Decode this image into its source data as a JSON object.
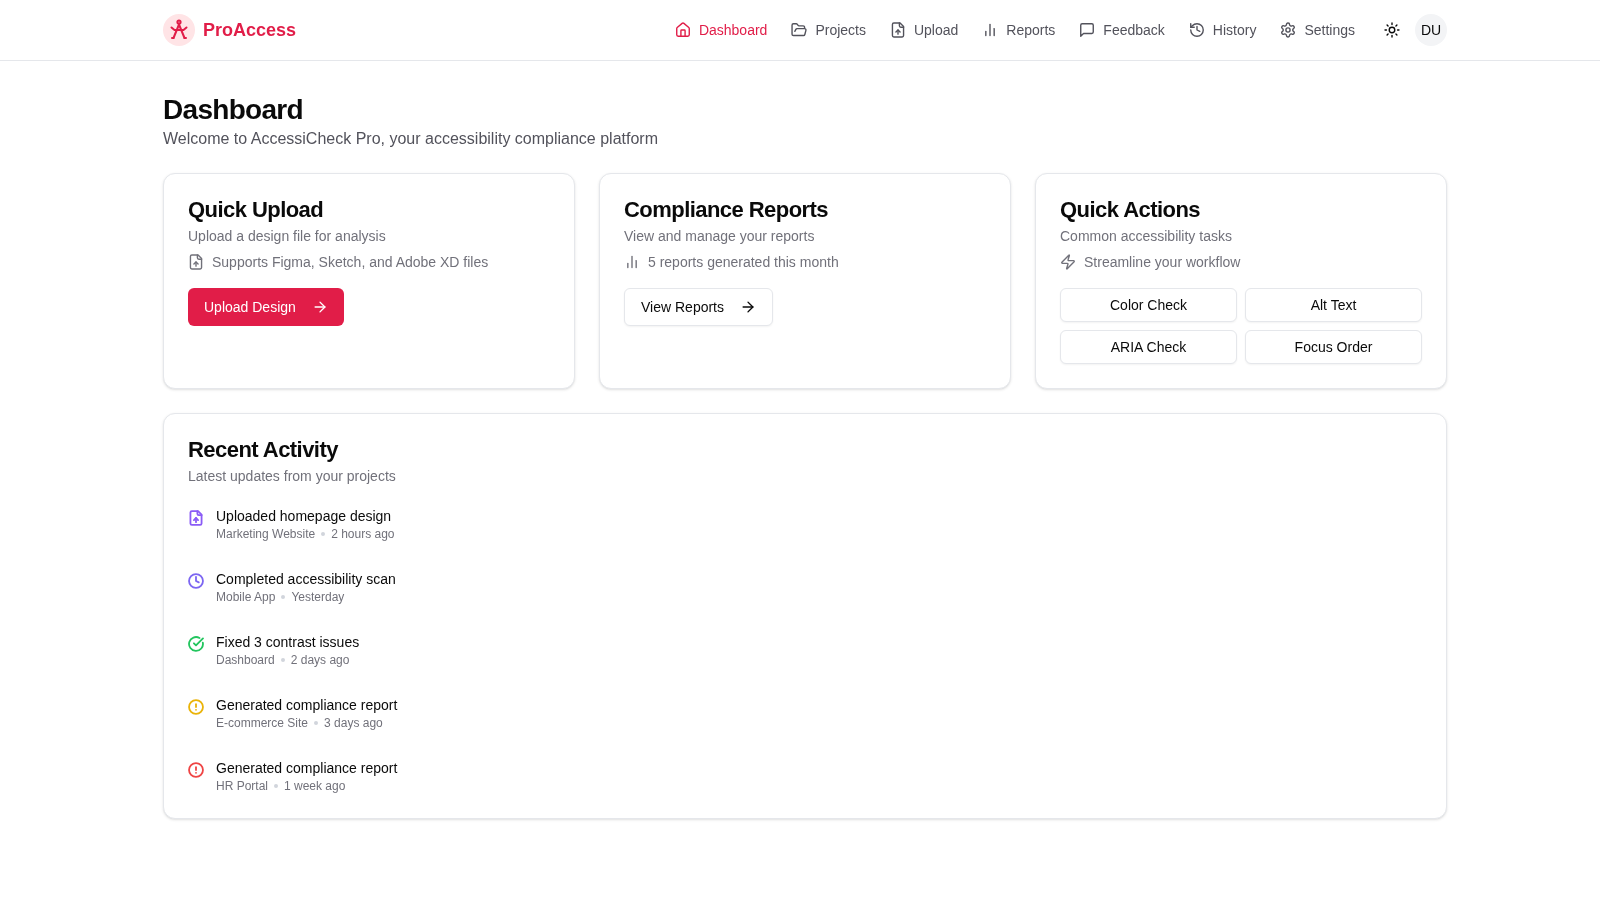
{
  "header": {
    "brand": "ProAccess",
    "nav": [
      {
        "label": "Dashboard",
        "selected": true
      },
      {
        "label": "Projects",
        "selected": false
      },
      {
        "label": "Upload",
        "selected": false
      },
      {
        "label": "Reports",
        "selected": false
      },
      {
        "label": "Feedback",
        "selected": false
      },
      {
        "label": "History",
        "selected": false
      },
      {
        "label": "Settings",
        "selected": false
      }
    ],
    "avatar": "DU"
  },
  "page": {
    "title": "Dashboard",
    "subtitle": "Welcome to AccessiCheck Pro, your accessibility compliance platform"
  },
  "cards": [
    {
      "kind": "upload",
      "title": "Quick Upload",
      "description": "Upload a design file for analysis",
      "note": "Supports Figma, Sketch, and Adobe XD files",
      "button": "Upload Design"
    },
    {
      "kind": "reports",
      "title": "Compliance Reports",
      "description": "View and manage your reports",
      "note": "5 reports generated this month",
      "button": "View Reports"
    },
    {
      "kind": "actions",
      "title": "Quick Actions",
      "description": "Common accessibility tasks",
      "note": "Streamline your workflow",
      "actions": [
        "Color Check",
        "Alt Text",
        "ARIA Check",
        "Focus Order"
      ]
    }
  ],
  "recent_activity": {
    "title": "Recent Activity",
    "description": "Latest updates from your projects",
    "items": [
      {
        "kind": "upload",
        "color": "#8b5cf6",
        "title": "Uploaded homepage design",
        "project": "Marketing Website",
        "time": "2 hours ago"
      },
      {
        "kind": "clock",
        "color": "#7c66f2",
        "title": "Completed accessibility scan",
        "project": "Mobile App",
        "time": "Yesterday"
      },
      {
        "kind": "check",
        "color": "#22c55e",
        "title": "Fixed 3 contrast issues",
        "project": "Dashboard",
        "time": "2 days ago"
      },
      {
        "kind": "alert",
        "color": "#eab308",
        "title": "Generated compliance report",
        "project": "E-commerce Site",
        "time": "3 days ago"
      },
      {
        "kind": "alert",
        "color": "#ef4444",
        "title": "Generated compliance report",
        "project": "HR Portal",
        "time": "1 week ago"
      }
    ]
  }
}
